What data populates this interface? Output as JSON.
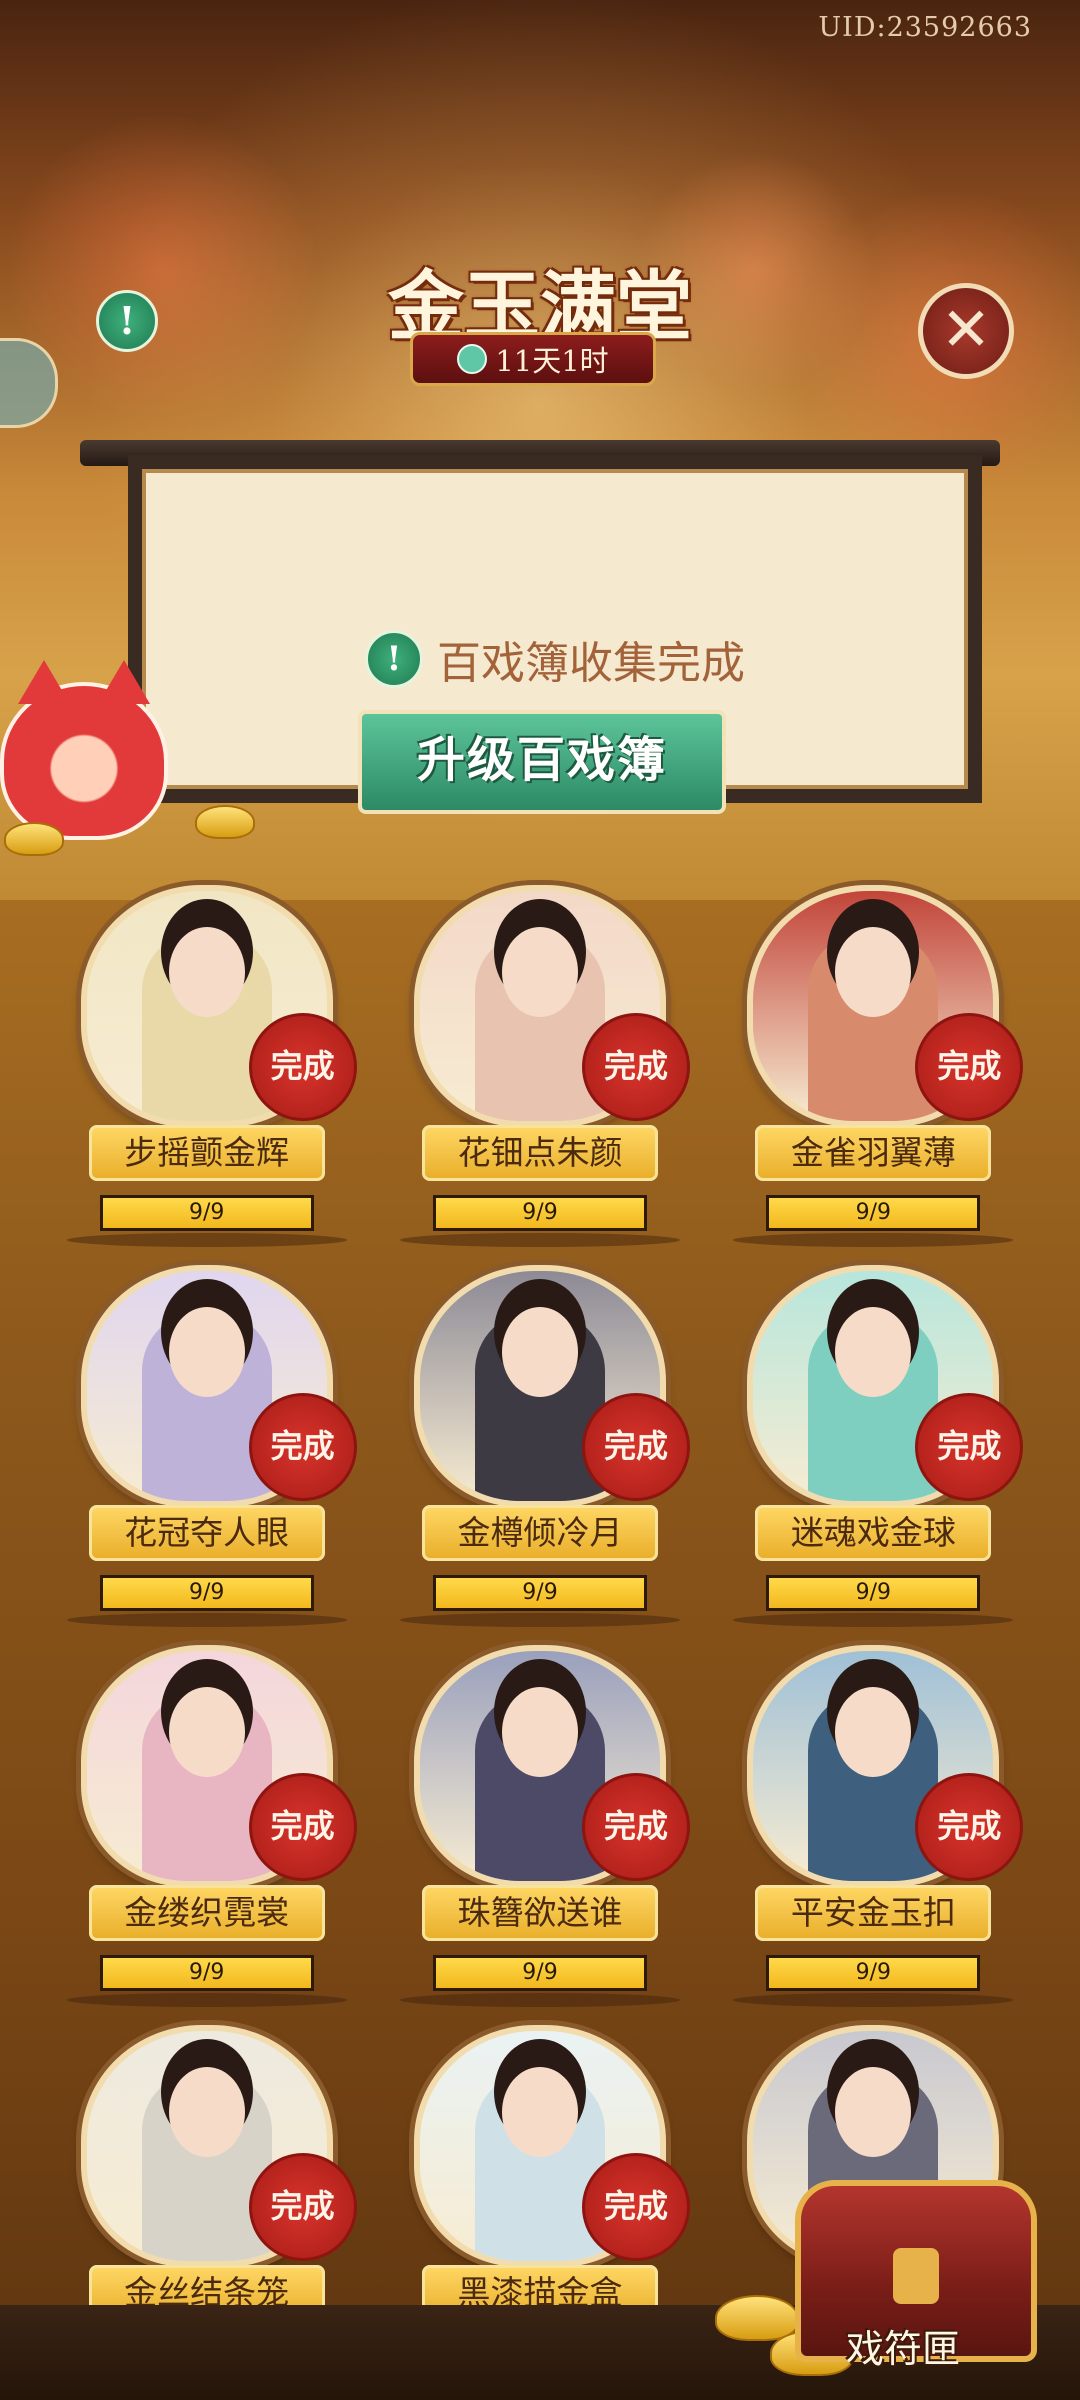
{
  "header": {
    "uid": "UID:23592663",
    "title": "金玉满堂",
    "timer": "11天1时",
    "alert_icon": "exclamation-icon",
    "close_icon": "close-icon"
  },
  "board": {
    "message": "百戏簿收集完成",
    "upgrade_button": "升级百戏簿"
  },
  "colors": {
    "accent_green": "#2c8a65",
    "stamp_red": "#d8342c",
    "plate_gold": "#ffd866"
  },
  "cards": [
    {
      "name": "步摇颤金辉",
      "status": "完成",
      "progress": "9/9",
      "fill": 1.0
    },
    {
      "name": "花钿点朱颜",
      "status": "完成",
      "progress": "9/9",
      "fill": 1.0
    },
    {
      "name": "金雀羽翼薄",
      "status": "完成",
      "progress": "9/9",
      "fill": 1.0
    },
    {
      "name": "花冠夺人眼",
      "status": "完成",
      "progress": "9/9",
      "fill": 1.0
    },
    {
      "name": "金樽倾冷月",
      "status": "完成",
      "progress": "9/9",
      "fill": 1.0
    },
    {
      "name": "迷魂戏金球",
      "status": "完成",
      "progress": "9/9",
      "fill": 1.0
    },
    {
      "name": "金缕织霓裳",
      "status": "完成",
      "progress": "9/9",
      "fill": 1.0
    },
    {
      "name": "珠簪欲送谁",
      "status": "完成",
      "progress": "9/9",
      "fill": 1.0
    },
    {
      "name": "平安金玉扣",
      "status": "完成",
      "progress": "9/9",
      "fill": 1.0
    },
    {
      "name": "金丝结条笼",
      "status": "完成",
      "progress": "",
      "fill": 1.0
    },
    {
      "name": "黑漆描金盒",
      "status": "完成",
      "progress": "",
      "fill": 1.0
    },
    {
      "name": "",
      "status": "",
      "progress": "",
      "fill": 1.0
    }
  ],
  "footer": {
    "chest_label": "戏符匣"
  }
}
